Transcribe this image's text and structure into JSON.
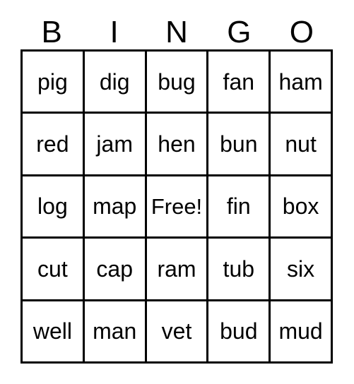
{
  "card": {
    "title": "BINGO",
    "header_letters": [
      "B",
      "I",
      "N",
      "G",
      "O"
    ],
    "free_space_label": "Free!",
    "free_space_index": {
      "row": 2,
      "col": 2
    },
    "grid_size": "5x5",
    "colors": {
      "background": "#ffffff",
      "border": "#000000",
      "text": "#000000"
    },
    "rows": [
      {
        "cells": [
          {
            "text": "pig"
          },
          {
            "text": "dig"
          },
          {
            "text": "bug"
          },
          {
            "text": "fan"
          },
          {
            "text": "ham"
          }
        ]
      },
      {
        "cells": [
          {
            "text": "red"
          },
          {
            "text": "jam"
          },
          {
            "text": "hen"
          },
          {
            "text": "bun"
          },
          {
            "text": "nut"
          }
        ]
      },
      {
        "cells": [
          {
            "text": "log"
          },
          {
            "text": "map"
          },
          {
            "text": "Free!"
          },
          {
            "text": "fin"
          },
          {
            "text": "box"
          }
        ]
      },
      {
        "cells": [
          {
            "text": "cut"
          },
          {
            "text": "cap"
          },
          {
            "text": "ram"
          },
          {
            "text": "tub"
          },
          {
            "text": "six"
          }
        ]
      },
      {
        "cells": [
          {
            "text": "well"
          },
          {
            "text": "man"
          },
          {
            "text": "vet"
          },
          {
            "text": "bud"
          },
          {
            "text": "mud"
          }
        ]
      }
    ]
  }
}
